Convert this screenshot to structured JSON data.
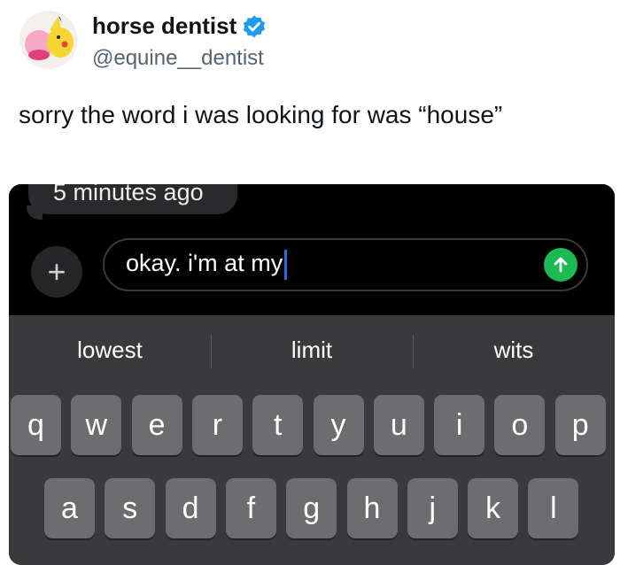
{
  "tweet": {
    "author_name": "horse dentist",
    "author_handle": "@equine__dentist",
    "text": "sorry the word i was looking for was “house”"
  },
  "icons": {
    "avatar": "pikachu-kirby-avatar",
    "verified": "verified-badge-icon",
    "send": "arrow-up-icon",
    "plus": "plus-icon"
  },
  "colors": {
    "verified_badge": "#1d9bf0",
    "send_button": "#1db954",
    "caret": "#2f6ddb",
    "keyboard_bg": "#3a3a3c",
    "key_bg": "#6d6d70"
  },
  "phone": {
    "timestamp": "5 minutes ago",
    "plus_label": "+",
    "input_value": "okay. i'm at my",
    "suggestions": [
      "lowest",
      "limit",
      "wits"
    ],
    "row1": [
      "q",
      "w",
      "e",
      "r",
      "t",
      "y",
      "u",
      "i",
      "o",
      "p"
    ],
    "row2": [
      "a",
      "s",
      "d",
      "f",
      "g",
      "h",
      "j",
      "k",
      "l"
    ]
  }
}
